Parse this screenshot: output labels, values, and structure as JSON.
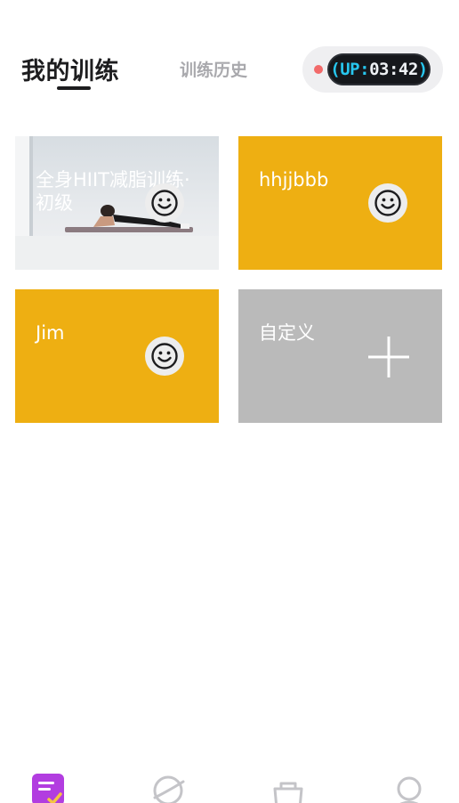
{
  "header": {
    "active_tab": "我的训练",
    "history_tab": "训练历史",
    "device_display": {
      "prefix": "UP:",
      "time": "03:42"
    }
  },
  "cards": [
    {
      "title": "全身HIIT减脂训练·初级",
      "style": "photo",
      "icon": "smiley-icon"
    },
    {
      "title": "hhjjbbb",
      "style": "yellow",
      "icon": "smiley-icon"
    },
    {
      "title": "Jim",
      "style": "yellow",
      "icon": "smiley-icon"
    },
    {
      "title": "自定义",
      "style": "gray",
      "icon": "plus-icon"
    }
  ],
  "bottom_nav": [
    {
      "icon": "training-list-icon",
      "active": true
    },
    {
      "icon": "discover-planet-icon",
      "active": false
    },
    {
      "icon": "shop-bag-icon",
      "active": false
    },
    {
      "icon": "profile-icon",
      "active": false
    }
  ],
  "colors": {
    "card_yellow": "#eeaf12",
    "card_gray": "#bababa",
    "nav_active": "#b23de0",
    "lcd_accent": "#27c6ee",
    "status_dot": "#f26a6a"
  }
}
